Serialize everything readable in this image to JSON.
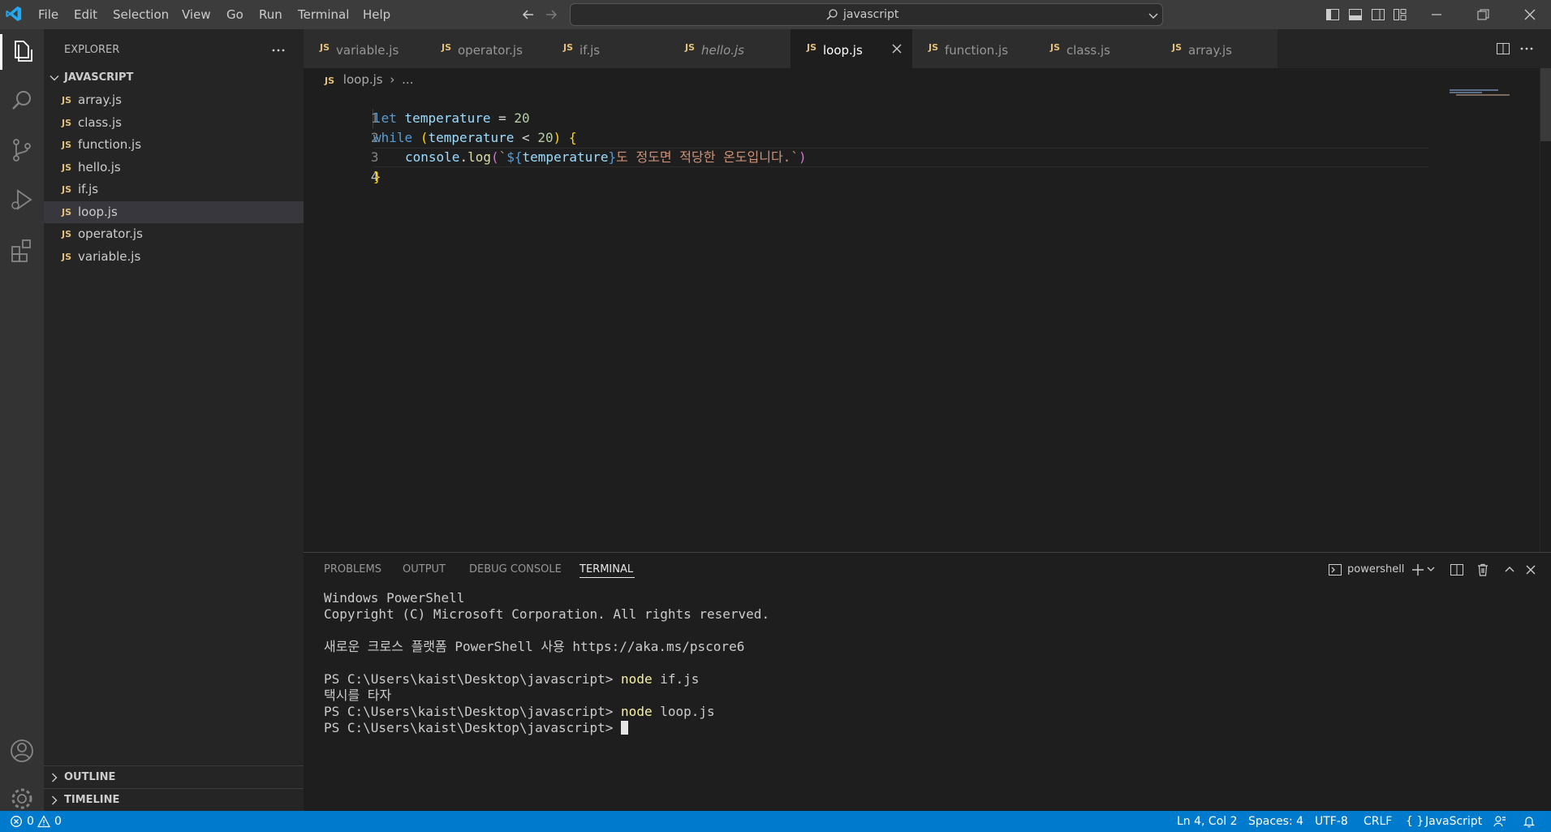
{
  "titlebar": {
    "menus": [
      "File",
      "Edit",
      "Selection",
      "View",
      "Go",
      "Run",
      "Terminal",
      "Help"
    ],
    "search_text": "javascript"
  },
  "explorer": {
    "title": "EXPLORER",
    "folder": "JAVASCRIPT",
    "files": [
      "array.js",
      "class.js",
      "function.js",
      "hello.js",
      "if.js",
      "loop.js",
      "operator.js",
      "variable.js"
    ],
    "selected": "loop.js",
    "outline": "OUTLINE",
    "timeline": "TIMELINE"
  },
  "tabs": [
    "variable.js",
    "operator.js",
    "if.js",
    "hello.js",
    "loop.js",
    "function.js",
    "class.js",
    "array.js"
  ],
  "active_tab": "loop.js",
  "breadcrumb": {
    "file": "loop.js",
    "more": "..."
  },
  "editor": {
    "line_numbers": [
      "1",
      "2",
      "3",
      "4"
    ],
    "code": {
      "l1_kw": "let",
      "l1_var": "temperature",
      "l1_op": " = ",
      "l1_num": "20",
      "l2_kw": "while",
      "l2_open": "(",
      "l2_var": "temperature",
      "l2_op": " < ",
      "l2_num": "20",
      "l2_close": ")",
      "l2_brace": "{",
      "l3_obj": "console",
      "l3_dot": ".",
      "l3_fn": "log",
      "l3_open": "(",
      "l3_tick1": "`",
      "l3_interp_open": "${",
      "l3_var": "temperature",
      "l3_interp_close": "}",
      "l3_str": "도 정도면 적당한 온도입니다.",
      "l3_tick2": "`",
      "l3_close": ")",
      "l4_brace": "}"
    }
  },
  "panel": {
    "tabs": [
      "PROBLEMS",
      "OUTPUT",
      "DEBUG CONSOLE",
      "TERMINAL"
    ],
    "active": "TERMINAL",
    "shell": "powershell",
    "lines": {
      "t1": "Windows PowerShell",
      "t2": "Copyright (C) Microsoft Corporation. All rights reserved.",
      "t3": "새로운 크로스 플랫폼 PowerShell 사용 https://aka.ms/pscore6",
      "prompt": "PS C:\\Users\\kaist\\Desktop\\javascript> ",
      "cmd_node": "node",
      "cmd1_arg": " if.js",
      "output1": "택시를 타자",
      "cmd2_arg": " loop.js"
    }
  },
  "statusbar": {
    "errors": "0",
    "warnings": "0",
    "position": "Ln 4, Col 2",
    "spaces": "Spaces: 4",
    "encoding": "UTF-8",
    "eol": "CRLF",
    "language": "JavaScript"
  },
  "colors": {
    "accent": "#007acc",
    "js_badge": "#e5c07b"
  }
}
